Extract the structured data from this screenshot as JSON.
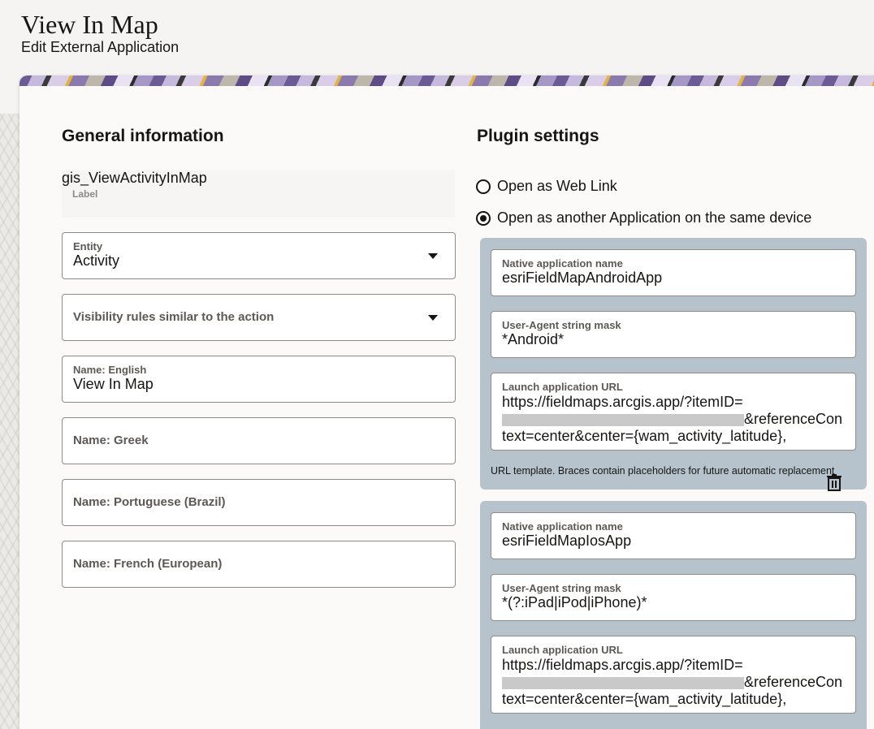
{
  "header": {
    "title": "View In Map",
    "subtitle": "Edit External Application"
  },
  "general": {
    "title": "General information",
    "label_field": {
      "value": "gis_ViewActivityInMap",
      "label": "Label"
    },
    "entity": {
      "label": "Entity",
      "value": "Activity"
    },
    "visibility": {
      "placeholder": "Visibility rules similar to the action"
    },
    "name_english": {
      "label": "Name: English",
      "value": "View In Map"
    },
    "name_greek": {
      "placeholder": "Name: Greek"
    },
    "name_portuguese": {
      "placeholder": "Name: Portuguese (Brazil)"
    },
    "name_french": {
      "placeholder": "Name: French (European)"
    }
  },
  "plugin": {
    "title": "Plugin settings",
    "options": [
      {
        "label": "Open as Web Link",
        "checked": false
      },
      {
        "label": "Open as another Application on the same device",
        "checked": true
      }
    ],
    "apps": [
      {
        "native_label": "Native application name",
        "native_value": "esriFieldMapAndroidApp",
        "ua_label": "User-Agent string mask",
        "ua_value": "*Android*",
        "url_label": "Launch application URL",
        "url_prefix": "https://fieldmaps.arcgis.app/?itemID=",
        "url_suffix": "&referenceContext=center&center={wam_activity_latitude},",
        "hint": "URL template. Braces contain placeholders for future automatic replacement"
      },
      {
        "native_label": "Native application name",
        "native_value": "esriFieldMapIosApp",
        "ua_label": "User-Agent string mask",
        "ua_value": "*(?:iPad|iPod|iPhone)*",
        "url_label": "Launch application URL",
        "url_prefix": "https://fieldmaps.arcgis.app/?itemID=",
        "url_suffix": "&referenceContext=center&center={wam_activity_latitude},"
      }
    ]
  },
  "icons": {
    "delete": "trash-icon"
  }
}
